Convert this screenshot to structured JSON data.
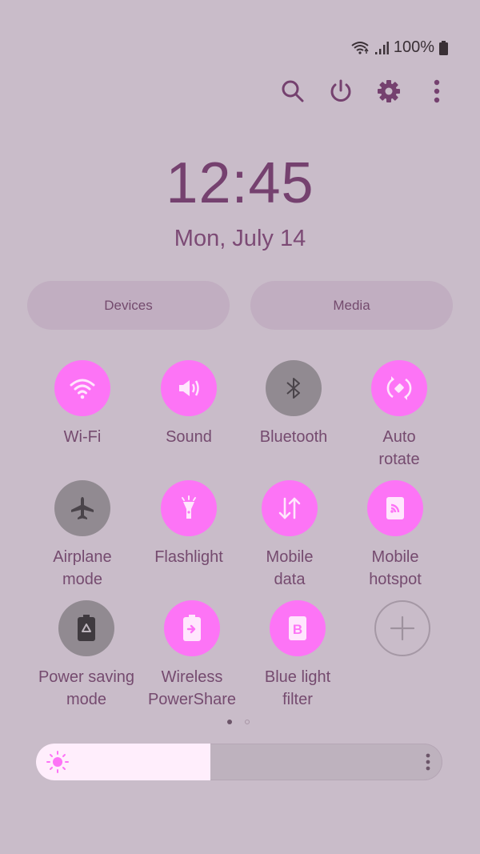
{
  "status_bar": {
    "battery_text": "100%",
    "icons": [
      "wifi-icon",
      "signal-icon",
      "battery-icon"
    ]
  },
  "toolbar": {
    "buttons": [
      {
        "name": "search",
        "icon": "search-icon"
      },
      {
        "name": "power",
        "icon": "power-icon"
      },
      {
        "name": "settings",
        "icon": "gear-icon"
      },
      {
        "name": "more",
        "icon": "more-vertical-icon"
      }
    ]
  },
  "clock": {
    "time": "12:45",
    "date": "Mon, July 14"
  },
  "buttons": {
    "devices": "Devices",
    "media": "Media"
  },
  "tiles": [
    {
      "label": "Wi-Fi",
      "icon": "wifi-icon",
      "state": "on"
    },
    {
      "label": "Sound",
      "icon": "sound-icon",
      "state": "on"
    },
    {
      "label": "Bluetooth",
      "icon": "bluetooth-icon",
      "state": "off"
    },
    {
      "label": "Auto\nrotate",
      "icon": "auto-rotate-icon",
      "state": "on"
    },
    {
      "label": "Airplane\nmode",
      "icon": "airplane-icon",
      "state": "off"
    },
    {
      "label": "Flashlight",
      "icon": "flashlight-icon",
      "state": "on"
    },
    {
      "label": "Mobile\ndata",
      "icon": "mobile-data-icon",
      "state": "on"
    },
    {
      "label": "Mobile\nhotspot",
      "icon": "hotspot-icon",
      "state": "on"
    },
    {
      "label": "Power saving\nmode",
      "icon": "power-saving-icon",
      "state": "off"
    },
    {
      "label": "Wireless\nPowerShare",
      "icon": "wireless-powershare-icon",
      "state": "on"
    },
    {
      "label": "Blue light\nfilter",
      "icon": "blue-light-filter-icon",
      "state": "on"
    },
    {
      "label": "",
      "icon": "add-icon",
      "state": "add"
    }
  ],
  "pagination": {
    "current": 1,
    "total": 2
  },
  "brightness": {
    "level_percent": 43
  },
  "colors": {
    "background": "#c9bcc9",
    "accent_on": "#fd74f6",
    "tile_off": "#918a91",
    "text": "#754b6f"
  }
}
